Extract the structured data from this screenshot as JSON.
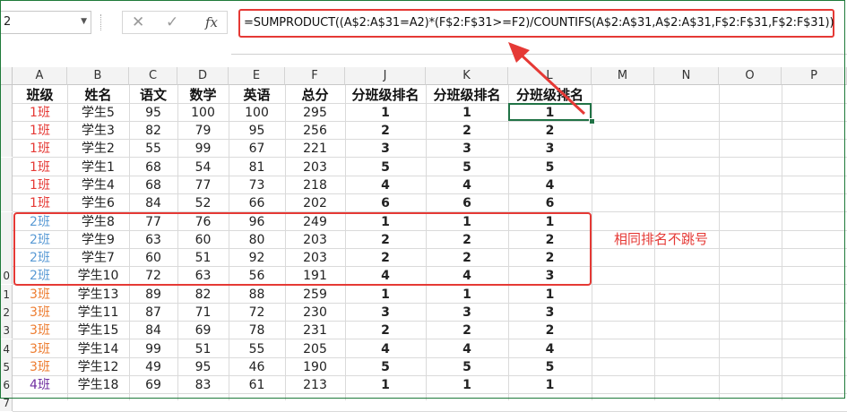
{
  "name_box": {
    "value": "2"
  },
  "formula_bar": {
    "cancel_icon": "✕",
    "enter_icon": "✓",
    "fx_label": "fx",
    "formula": "=SUMPRODUCT((A$2:A$31=A2)*(F$2:F$31>=F2)/COUNTIFS(A$2:A$31,A$2:A$31,F$2:F$31,F$2:F$31))"
  },
  "columns": [
    "A",
    "B",
    "C",
    "D",
    "E",
    "F",
    "J",
    "K",
    "L",
    "M",
    "N",
    "O",
    "P"
  ],
  "row_numbers": [
    "",
    "",
    "",
    "",
    "",
    "",
    "",
    "",
    "",
    "",
    "0",
    "1",
    "2",
    "3",
    "4",
    "5",
    "6",
    "7"
  ],
  "headers": [
    "班级",
    "姓名",
    "语文",
    "数学",
    "英语",
    "总分",
    "分班级排名",
    "分班级排名",
    "分班级排名"
  ],
  "rows": [
    {
      "cls": "1班",
      "name": "学生5",
      "c": "95",
      "d": "100",
      "e": "100",
      "f": "295",
      "j": "1",
      "k": "1",
      "l": "1"
    },
    {
      "cls": "1班",
      "name": "学生3",
      "c": "82",
      "d": "79",
      "e": "95",
      "f": "256",
      "j": "2",
      "k": "2",
      "l": "2"
    },
    {
      "cls": "1班",
      "name": "学生2",
      "c": "55",
      "d": "99",
      "e": "67",
      "f": "221",
      "j": "3",
      "k": "3",
      "l": "3"
    },
    {
      "cls": "1班",
      "name": "学生1",
      "c": "68",
      "d": "54",
      "e": "81",
      "f": "203",
      "j": "5",
      "k": "5",
      "l": "5"
    },
    {
      "cls": "1班",
      "name": "学生4",
      "c": "68",
      "d": "77",
      "e": "73",
      "f": "218",
      "j": "4",
      "k": "4",
      "l": "4"
    },
    {
      "cls": "1班",
      "name": "学生6",
      "c": "84",
      "d": "52",
      "e": "66",
      "f": "202",
      "j": "6",
      "k": "6",
      "l": "6"
    },
    {
      "cls": "2班",
      "name": "学生8",
      "c": "77",
      "d": "76",
      "e": "96",
      "f": "249",
      "j": "1",
      "k": "1",
      "l": "1"
    },
    {
      "cls": "2班",
      "name": "学生9",
      "c": "63",
      "d": "60",
      "e": "80",
      "f": "203",
      "j": "2",
      "k": "2",
      "l": "2"
    },
    {
      "cls": "2班",
      "name": "学生7",
      "c": "60",
      "d": "51",
      "e": "92",
      "f": "203",
      "j": "2",
      "k": "2",
      "l": "2"
    },
    {
      "cls": "2班",
      "name": "学生10",
      "c": "72",
      "d": "63",
      "e": "56",
      "f": "191",
      "j": "4",
      "k": "4",
      "l": "3"
    },
    {
      "cls": "3班",
      "name": "学生13",
      "c": "89",
      "d": "82",
      "e": "88",
      "f": "259",
      "j": "1",
      "k": "1",
      "l": "1"
    },
    {
      "cls": "3班",
      "name": "学生11",
      "c": "87",
      "d": "71",
      "e": "72",
      "f": "230",
      "j": "3",
      "k": "3",
      "l": "3"
    },
    {
      "cls": "3班",
      "name": "学生15",
      "c": "84",
      "d": "69",
      "e": "78",
      "f": "231",
      "j": "2",
      "k": "2",
      "l": "2"
    },
    {
      "cls": "3班",
      "name": "学生14",
      "c": "99",
      "d": "51",
      "e": "55",
      "f": "205",
      "j": "4",
      "k": "4",
      "l": "4"
    },
    {
      "cls": "3班",
      "name": "学生12",
      "c": "49",
      "d": "95",
      "e": "46",
      "f": "190",
      "j": "5",
      "k": "5",
      "l": "5"
    },
    {
      "cls": "4班",
      "name": "学生18",
      "c": "69",
      "d": "83",
      "e": "61",
      "f": "213",
      "j": "1",
      "k": "1",
      "l": "1"
    }
  ],
  "class_colors": {
    "1班": "#e53935",
    "2班": "#5b9bd5",
    "3班": "#ed7d31",
    "4班": "#7030a0"
  },
  "annotation": {
    "text": "相同排名不跳号",
    "color": "#e53935"
  }
}
